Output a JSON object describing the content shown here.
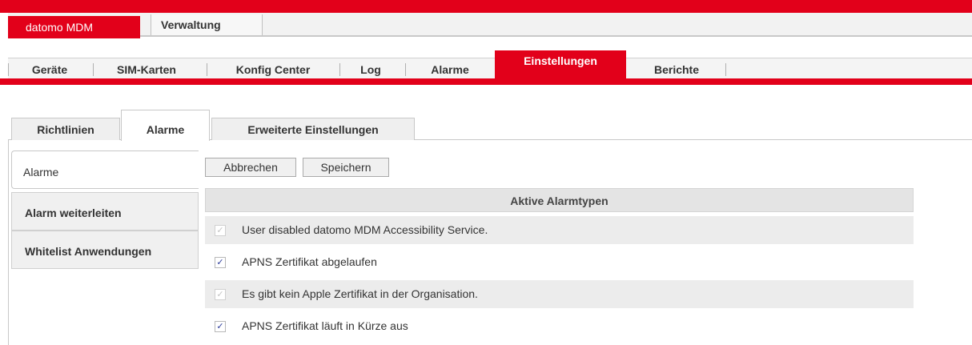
{
  "app_tabs": {
    "active": "datomo MDM",
    "other": "Verwaltung"
  },
  "main_nav": [
    "Geräte",
    "SIM-Karten",
    "Konfig Center",
    "Log",
    "Alarme",
    "Einstellungen",
    "Berichte"
  ],
  "main_nav_active": "Einstellungen",
  "sub_tabs": [
    "Richtlinien",
    "Alarme",
    "Erweiterte Einstellungen"
  ],
  "sub_tab_active": "Alarme",
  "side_nav": [
    "Alarme",
    "Alarm weiterleiten",
    "Whitelist Anwendungen"
  ],
  "side_nav_active": "Alarme",
  "buttons": {
    "cancel": "Abbrechen",
    "save": "Speichern"
  },
  "table": {
    "header": "Aktive Alarmtypen",
    "rows": [
      {
        "label": "User disabled datomo MDM Accessibility Service.",
        "checked": true,
        "disabled": true
      },
      {
        "label": "APNS Zertifikat abgelaufen",
        "checked": true,
        "disabled": false
      },
      {
        "label": "Es gibt kein Apple Zertifikat in der Organisation.",
        "checked": true,
        "disabled": true
      },
      {
        "label": "APNS Zertifikat läuft in Kürze aus",
        "checked": true,
        "disabled": false
      }
    ]
  },
  "colors": {
    "brand_red": "#e2001a",
    "checkbox_check": "#2a3a9a"
  },
  "icons": {
    "checkbox": "check-icon"
  }
}
